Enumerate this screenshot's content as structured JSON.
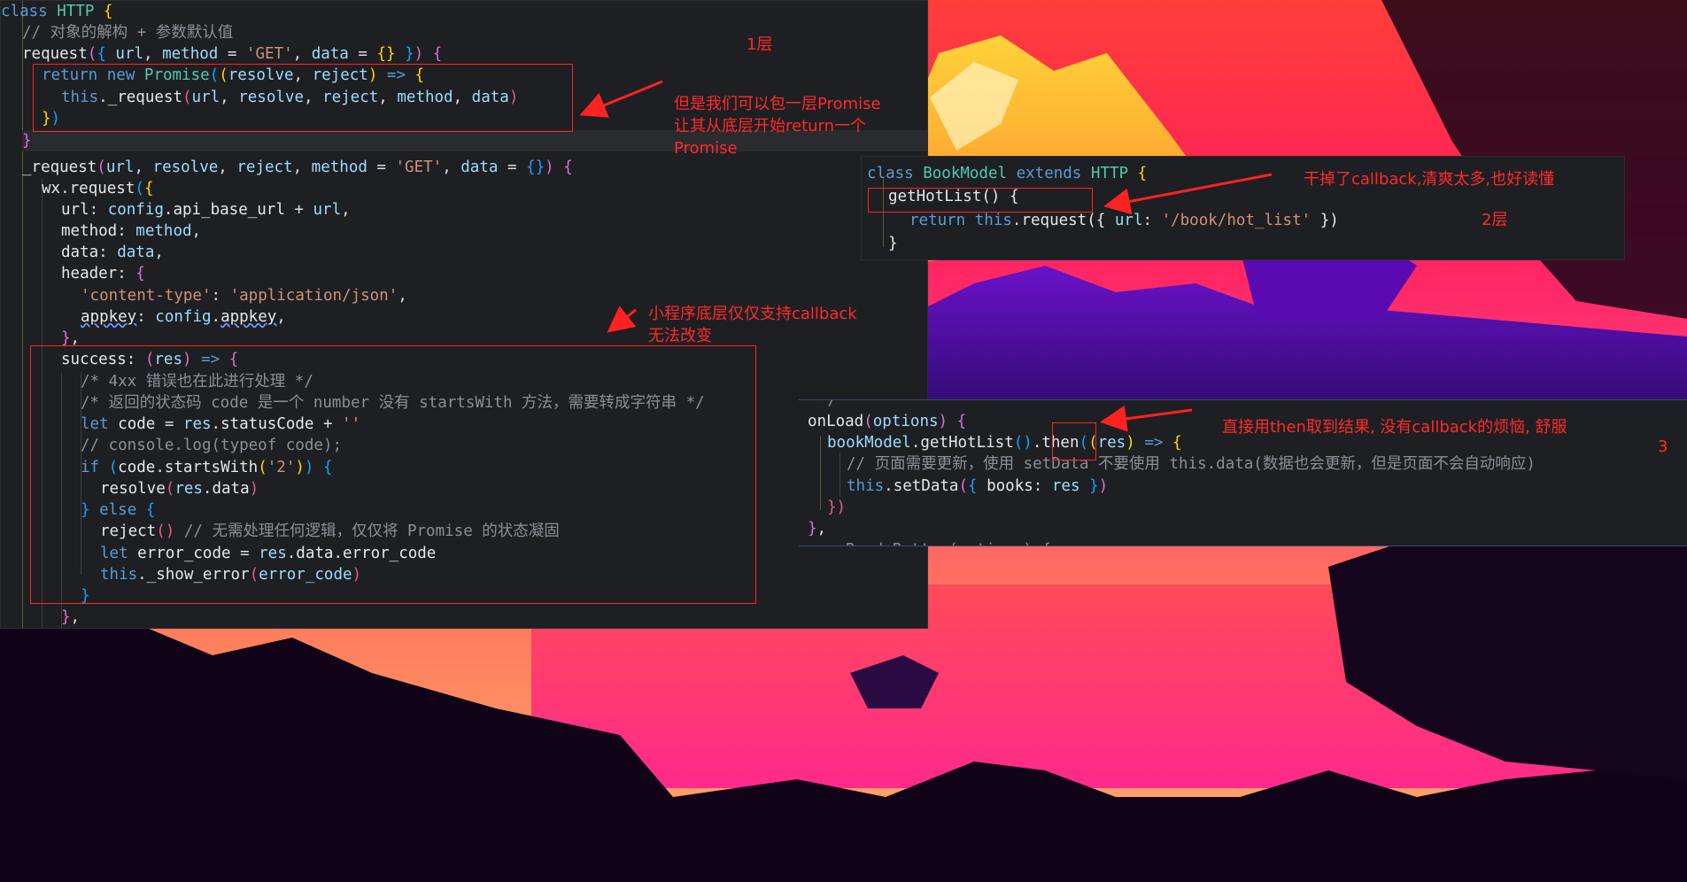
{
  "panel1": {
    "lines": [
      "class HTTP {",
      "  // 对象的解构 + 参数默认值",
      "  request({ url, method = 'GET', data = {} }) {",
      "    return new Promise((resolve, reject) => {",
      "      this._request(url, resolve, reject, method, data)",
      "    })",
      "  }",
      "  _request(url, resolve, reject, method = 'GET', data = {}) {",
      "    wx.request({",
      "      url: config.api_base_url + url,",
      "      method: method,",
      "      data: data,",
      "      header: {",
      "        'content-type': 'application/json',",
      "        appkey: config.appkey,",
      "      },",
      "      success: (res) => {",
      "        /* 4xx 错误也在此进行处理 */",
      "        /* 返回的状态码 code 是一个 number 没有 startsWith 方法，需要转成字符串 */",
      "        let code = res.statusCode + ''",
      "        // console.log(typeof code);",
      "        if (code.startsWith('2')) {",
      "          resolve(res.data)",
      "        } else {",
      "          reject() // 无需处理任何逻辑，仅仅将 Promise 的状态凝固",
      "          let error_code = res.data.error_code",
      "          this._show_error(error_code)",
      "        }",
      "      },"
    ]
  },
  "panel2": {
    "lines": [
      "class BookModel extends HTTP {",
      "  getHotList() {",
      "    return this.request({ url: '/book/hot_list' })",
      "  }"
    ]
  },
  "panel3": {
    "lines": [
      "  */",
      "onLoad(options) {",
      "  bookModel.getHotList().then((res) => {",
      "    // 页面需要更新，使用 setData 不要使用 this.data(数据也会更新，但是页面不会自动响应)",
      "    this.setData({ books: res })",
      "  })",
      "},",
      "  onReadyButton(options) {"
    ]
  },
  "annotations": {
    "layer1": "1层",
    "wrap_promise": [
      "但是我们可以包一层Promise",
      "让其从底层开始return一个",
      "Promise"
    ],
    "callback_only": [
      "小程序底层仅仅支持callback",
      "无法改变"
    ],
    "no_callback": "干掉了callback,清爽太多,也好读懂",
    "layer2": "2层",
    "use_then": "直接用then取到结果, 没有callback的烦恼, 舒服",
    "layer3": "3"
  },
  "colors": {
    "annotation": "#ff2a2a",
    "editor_bg": "#1e1f22"
  }
}
